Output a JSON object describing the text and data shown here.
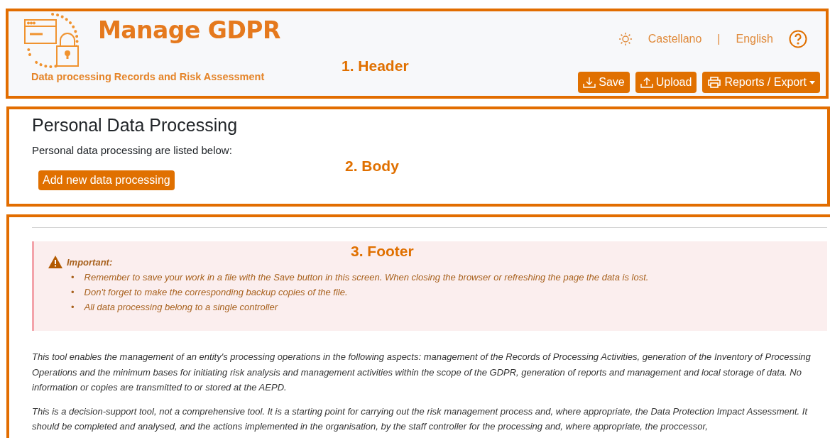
{
  "header": {
    "title": "Manage GDPR",
    "subtitle": "Data processing Records and Risk Assessment",
    "annotation": "1. Header",
    "languages": [
      {
        "label": "Castellano",
        "selected": false
      },
      {
        "label": "English",
        "selected": false
      }
    ],
    "separator": "|",
    "buttons": [
      {
        "label": "Save",
        "kind": "download"
      },
      {
        "label": "Upload",
        "kind": "upload"
      },
      {
        "label": "Reports / Export",
        "kind": "menu"
      }
    ]
  },
  "body": {
    "title": "Personal Data Processing",
    "text": "Personal data processing are listed below:",
    "annotation": "2. Body",
    "button": "Add new data processing"
  },
  "footer": {
    "annotation": "3. Footer",
    "alert": {
      "title": "Important:",
      "items": [
        {
          "marker": "•",
          "text": "Remember to save your work in a file with the Save button in this screen. When closing the browser or refreshing the page the data is lost."
        },
        {
          "marker": "•",
          "text": "Don't forget to make the corresponding backup copies of the file."
        },
        {
          "marker": "•",
          "text": "All data processing belong to a single controller"
        }
      ]
    },
    "paragraphs": [
      "This tool enables the management of an entity's processing operations in the following aspects: management of the Records of Processing Activities, generation of the Inventory of Processing Operations and the minimum bases for initiating risk analysis and management activities within the scope of the GDPR, generation of reports and management and local storage of data. No information or copies are transmitted to or stored at the AEPD.",
      "This is a decision-support tool, not a comprehensive tool. It is a starting point for carrying out the risk management process and, where appropriate, the Data Protection Impact Assessment. It should be completed and analysed, and the actions implemented in the organisation, by the staff controller for the processing and, where appropriate, the proccessor,"
    ]
  }
}
